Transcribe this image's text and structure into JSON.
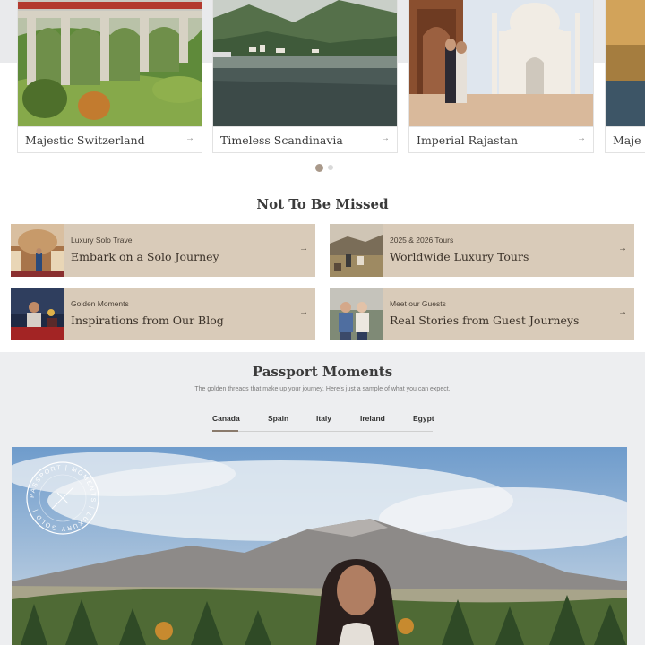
{
  "carousel": {
    "cards": [
      {
        "label": "Majestic Switzerland"
      },
      {
        "label": "Timeless Scandinavia"
      },
      {
        "label": "Imperial Rajastan"
      },
      {
        "label": "Maje"
      }
    ],
    "arrow": "→",
    "active_slide": 1,
    "total_slides": 2
  },
  "not_to_be_missed": {
    "title": "Not To Be Missed",
    "cards": [
      {
        "kicker": "Luxury Solo Travel",
        "heading": "Embark on a Solo Journey"
      },
      {
        "kicker": "2025 & 2026 Tours",
        "heading": "Worldwide Luxury Tours"
      },
      {
        "kicker": "Golden Moments",
        "heading": "Inspirations from Our Blog"
      },
      {
        "kicker": "Meet our Guests",
        "heading": "Real Stories from Guest Journeys"
      }
    ],
    "arrow": "→"
  },
  "passport_moments": {
    "title": "Passport Moments",
    "subtitle": "The golden threads that make up your journey. Here's just a sample of what you can expect.",
    "tabs": [
      {
        "label": "Canada",
        "active": true
      },
      {
        "label": "Spain",
        "active": false
      },
      {
        "label": "Italy",
        "active": false
      },
      {
        "label": "Ireland",
        "active": false
      },
      {
        "label": "Egypt",
        "active": false
      }
    ],
    "stamp_text": "PASSPORT | MOMENTS | LUXURY GOLD |"
  },
  "colors": {
    "card_beige": "#d9cbb9",
    "section_grey": "#edeef0",
    "accent_underline": "#8a7a6c"
  }
}
